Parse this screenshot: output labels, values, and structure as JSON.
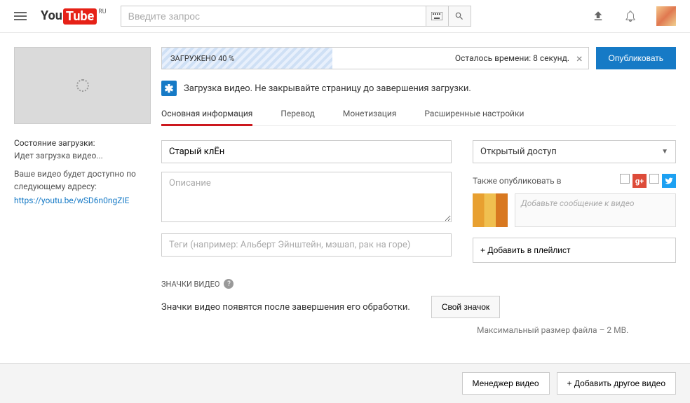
{
  "header": {
    "logo_you": "You",
    "logo_tube": "Tube",
    "logo_region": "RU",
    "search_placeholder": "Введите запрос"
  },
  "sidebar": {
    "status_title": "Состояние загрузки:",
    "status_line": "Идет загрузка видео...",
    "status_desc": "Ваше видео будет доступно по следующему адресу:",
    "video_url": "https://youtu.be/wSD6n0ngZIE"
  },
  "upload": {
    "progress_label": "ЗАГРУЖЕНО 40 %",
    "time_remaining": "Осталось времени: 8 секунд.",
    "publish_btn": "Опубликовать",
    "info_message": "Загрузка видео. Не закрывайте страницу до завершения загрузки."
  },
  "tabs": [
    {
      "label": "Основная информация"
    },
    {
      "label": "Перевод"
    },
    {
      "label": "Монетизация"
    },
    {
      "label": "Расширенные настройки"
    }
  ],
  "form": {
    "title_value": "Старый клЁн",
    "description_placeholder": "Описание",
    "tags_placeholder": "Теги (например: Альберт Эйнштейн, мэшап, рак на горе)",
    "privacy_value": "Открытый доступ",
    "share_label": "Также опубликовать в",
    "share_message_placeholder": "Добавьте сообщение к видео",
    "playlist_btn": "+ Добавить в плейлист"
  },
  "thumbnails": {
    "section_title": "ЗНАЧКИ ВИДЕО",
    "description": "Значки видео появятся после завершения его обработки.",
    "custom_btn": "Свой значок",
    "max_size_note": "Максимальный размер файла – 2 MB."
  },
  "footer": {
    "manager_btn": "Менеджер видео",
    "add_another_btn": "+  Добавить другое видео"
  },
  "social": {
    "gplus": "g+"
  }
}
